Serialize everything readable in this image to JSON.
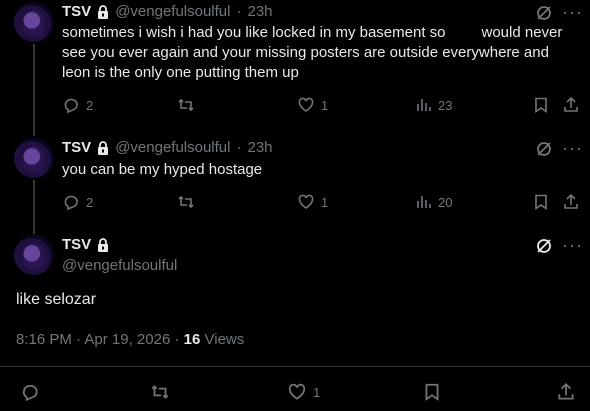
{
  "replies": [
    {
      "display_name": "TSV",
      "handle": "@vengefulsoulful",
      "separator": "·",
      "time": "23h",
      "text_line1": "sometimes i wish i had you like locked in my basement so",
      "text_line1_cont": "would never",
      "text_line2": "see you ever again and your missing posters are outside everywhere and",
      "text_line3": "leon is the only one putting them up",
      "replies": "2",
      "likes": "1",
      "views": "23"
    },
    {
      "display_name": "TSV",
      "handle": "@vengefulsoulful",
      "separator": "·",
      "time": "23h",
      "text_line1": "you can be my hyped hostage",
      "replies": "2",
      "likes": "1",
      "views": "20"
    }
  ],
  "main": {
    "display_name": "TSV",
    "handle": "@vengefulsoulful",
    "text": "like selozar",
    "time": "8:16 PM",
    "separator1": "·",
    "date": "Apr 19, 2026",
    "separator2": "·",
    "views_count": "16",
    "views_label": "Views",
    "likes": "1"
  },
  "colors": {
    "background": "#000000",
    "text": "#e7e9ea",
    "muted": "#71767b",
    "divider": "#2f3336"
  },
  "icons": {
    "reply": "reply-icon",
    "retweet": "retweet-icon",
    "like": "heart-icon",
    "views": "views-icon",
    "bookmark": "bookmark-icon",
    "share": "share-icon",
    "grok": "grok-icon",
    "more": "more-icon",
    "lock": "lock-icon"
  }
}
